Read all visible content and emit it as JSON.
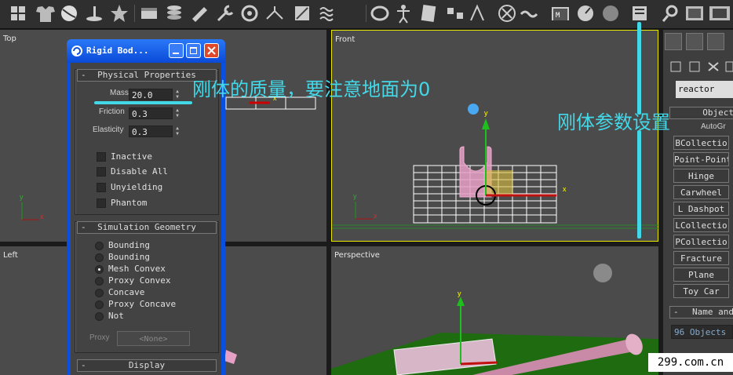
{
  "toolbar": {
    "icons": [
      "create-icon",
      "shirt-icon",
      "sphere-icon",
      "lamp-icon",
      "star-icon",
      "box-icon",
      "layers-icon",
      "pencil-icon",
      "wrench-icon",
      "gear-icon",
      "network-icon",
      "color-icon",
      "wave-icon",
      "torus-icon",
      "figure-icon",
      "note-icon",
      "link-icon",
      "arrows-icon",
      "target-icon",
      "tilde-icon",
      "motor-icon",
      "meter-icon",
      "globe-icon",
      "properties-icon",
      "magnify-icon",
      "render-icon",
      "film-icon"
    ]
  },
  "viewports": {
    "top": {
      "label": "Top"
    },
    "front": {
      "label": "Front"
    },
    "left": {
      "label": "Left"
    },
    "perspective": {
      "label": "Perspective"
    }
  },
  "axes": {
    "x": "x",
    "y": "y"
  },
  "dialog": {
    "title": "Rigid Bod...",
    "physical": {
      "header": "Physical Properties",
      "mass_label": "Mass",
      "mass_value": "20.0",
      "friction_label": "Friction",
      "friction_value": "0.3",
      "elasticity_label": "Elasticity",
      "elasticity_value": "0.3",
      "checkboxes": [
        "Inactive",
        "Disable All",
        "Unyielding",
        "Phantom"
      ]
    },
    "simulation": {
      "header": "Simulation Geometry",
      "options": [
        "Bounding",
        "Bounding",
        "Mesh Convex",
        "Proxy Convex",
        "Concave",
        "Proxy Concave",
        "Not"
      ],
      "selected_index": 2,
      "proxy_label": "Proxy",
      "proxy_button": "<None>"
    },
    "display": {
      "header": "Display"
    }
  },
  "command_panel": {
    "dropdown": "reactor",
    "object_type_header": "Object",
    "autogrid": "AutoGr",
    "buttons": [
      "BCollectio",
      "Point-Point",
      "Hinge",
      "Carwheel",
      "L Dashpot",
      "LCollectio",
      "PCollectio",
      "Fracture",
      "Plane",
      "Toy Car"
    ],
    "name_header": "Name and",
    "name_field": "96 Objects"
  },
  "annotations": {
    "mass_note": "刚体的质量，要注意地面为0",
    "param_note": "刚体参数设置"
  },
  "watermark": "299.com.cn",
  "colors": {
    "accent_cyan": "#43d8e8",
    "title_blue": "#0a4fe0",
    "active_border": "#e8e800"
  }
}
